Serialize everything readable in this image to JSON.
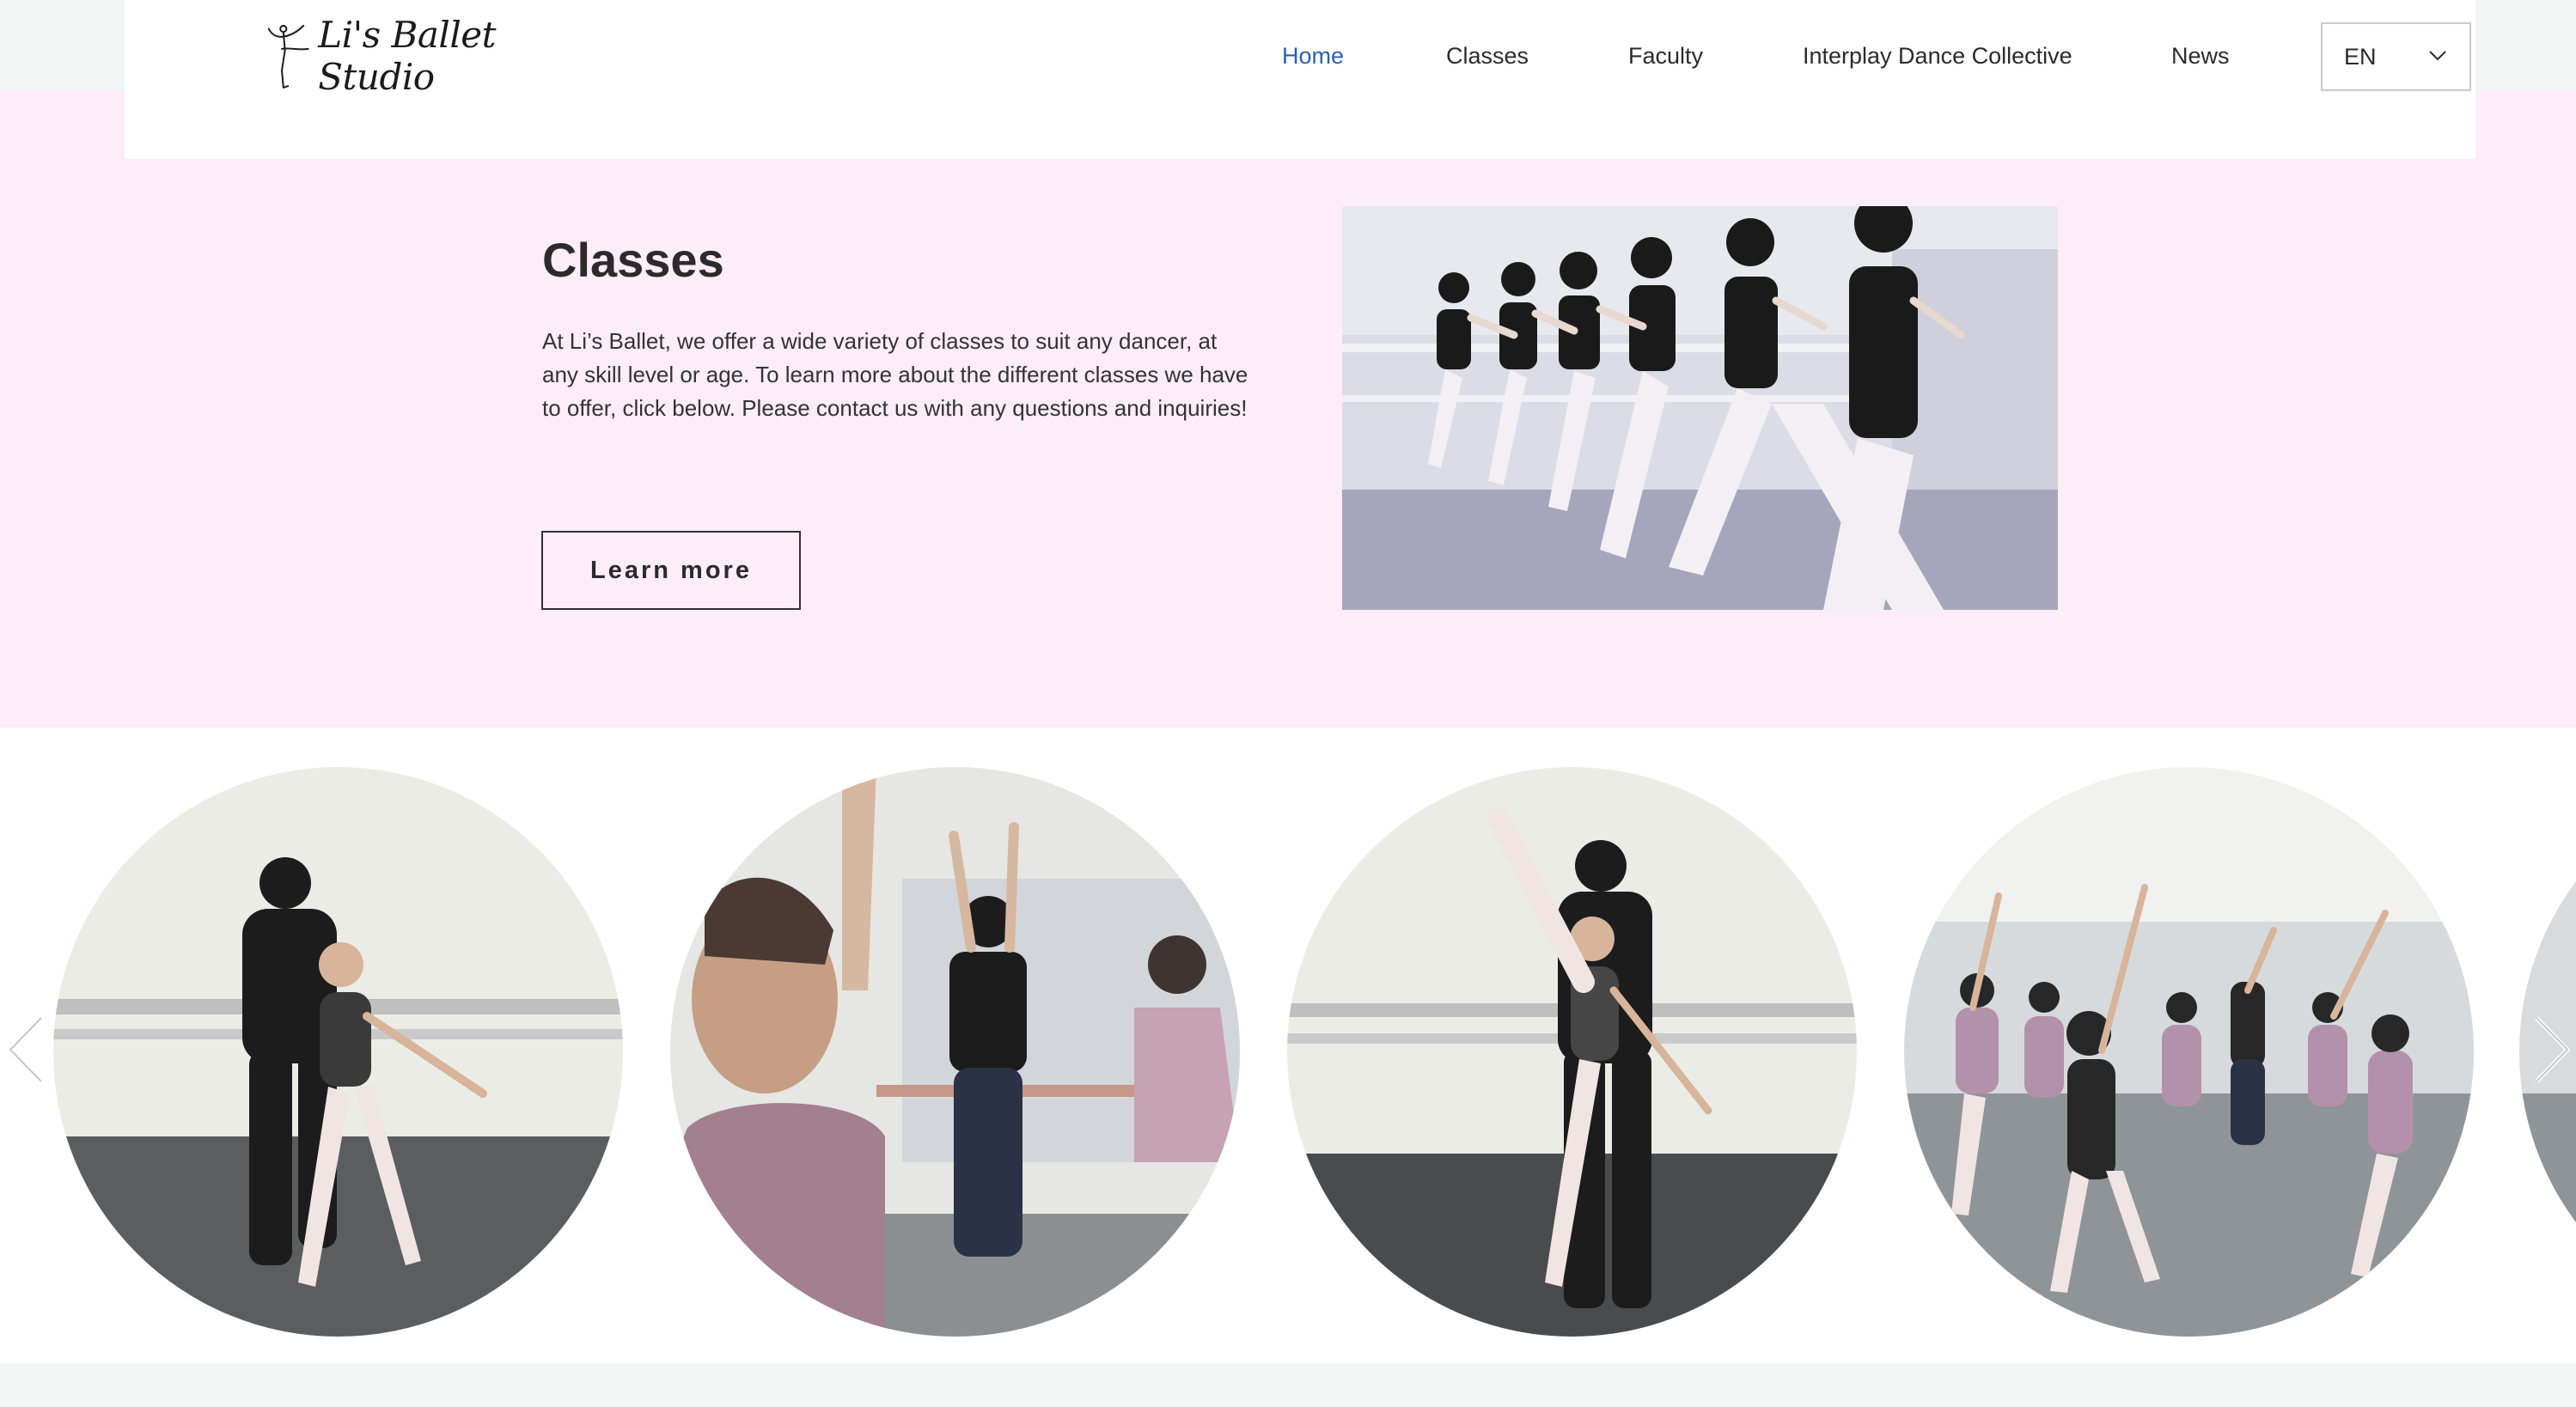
{
  "brand": {
    "name": "Li's Ballet Studio",
    "logo_icon": "ballerina-icon"
  },
  "nav": {
    "items": [
      {
        "label": "Home",
        "active": true
      },
      {
        "label": "Classes",
        "active": false
      },
      {
        "label": "Faculty",
        "active": false
      },
      {
        "label": "Interplay Dance Collective",
        "active": false
      },
      {
        "label": "News",
        "active": false
      }
    ],
    "active_color": "#2c5fb0"
  },
  "language": {
    "selected": "EN",
    "icon": "chevron-down-icon"
  },
  "intro": {
    "title": "Classes",
    "text": "At Li’s Ballet, we offer a wide variety of classes to suit any dancer, at any skill level or age. To learn more about the different classes we have to offer, click below. Please contact us with any questions and inquiries!",
    "button_label": "Learn more"
  },
  "carousel": {
    "prev_icon": "chevron-left-icon",
    "next_icon": "chevron-right-icon"
  },
  "colors": {
    "pink_background": "#fcedf8",
    "page_background": "#f4f6f6",
    "text": "#2b2b2b"
  }
}
